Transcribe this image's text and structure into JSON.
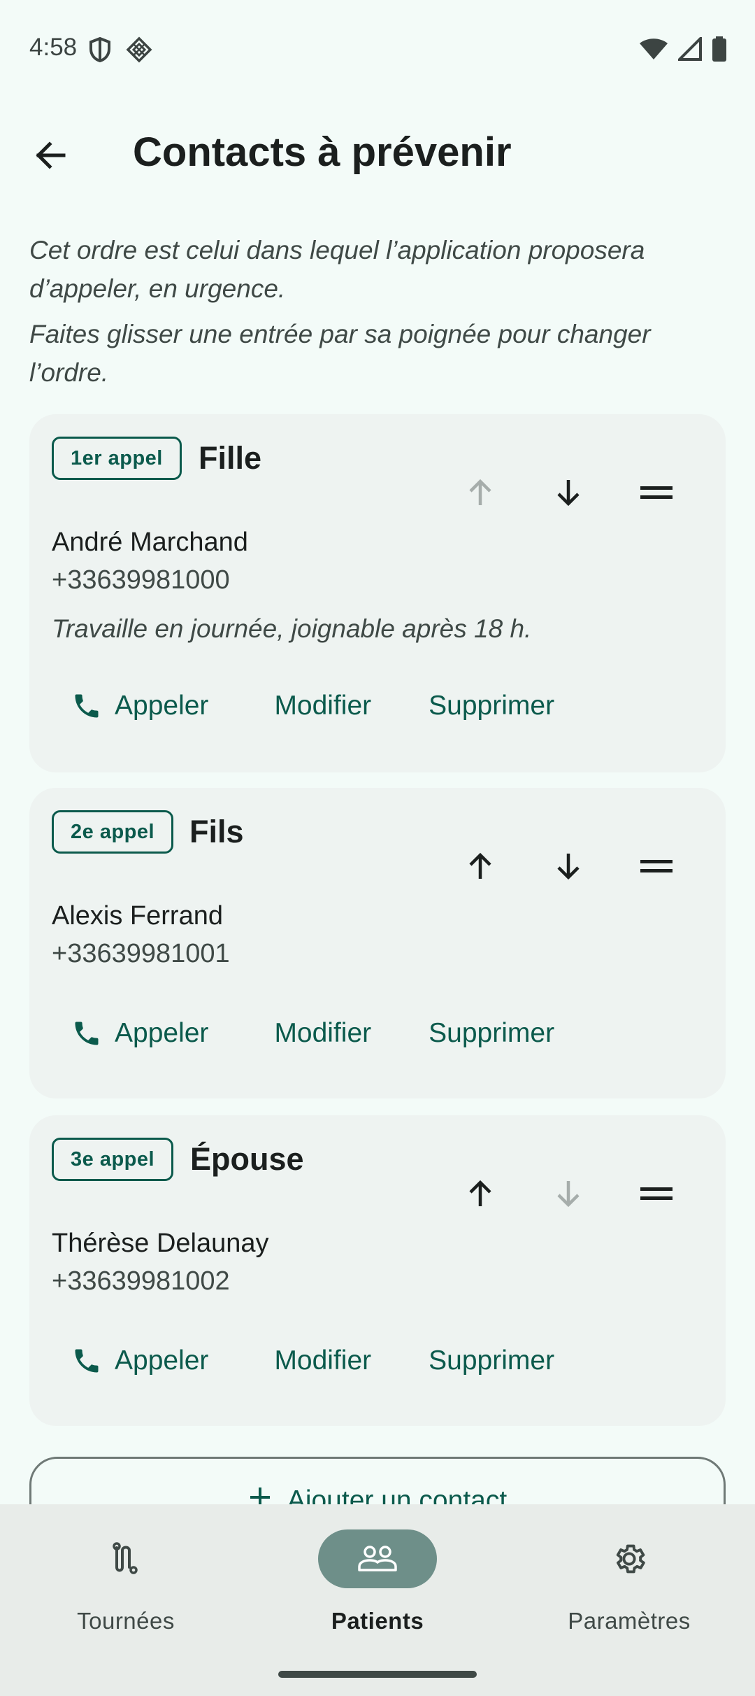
{
  "status_bar": {
    "time": "4:58",
    "left_icons": [
      "shield-icon",
      "diamond-grid-icon"
    ],
    "right_icons": [
      "wifi-icon",
      "signal-icon",
      "battery-icon"
    ]
  },
  "app_bar": {
    "title": "Contacts à prévenir",
    "back_icon": "arrow-back-icon"
  },
  "intro": {
    "line1": "Cet ordre est celui dans lequel l’application proposera d’appeler, en urgence.",
    "line2": "Faites glisser une entrée par sa poignée pour changer l’ordre."
  },
  "contacts": [
    {
      "badge": "1er appel",
      "relation": "Fille",
      "name": "André Marchand",
      "phone": "+33639981000",
      "note": "Travaille en journée, joignable après 18 h.",
      "up_enabled": false,
      "down_enabled": true
    },
    {
      "badge": "2e appel",
      "relation": "Fils",
      "name": "Alexis Ferrand",
      "phone": "+33639981001",
      "note": "",
      "up_enabled": true,
      "down_enabled": true
    },
    {
      "badge": "3e appel",
      "relation": "Épouse",
      "name": "Thérèse Delaunay",
      "phone": "+33639981002",
      "note": "",
      "up_enabled": true,
      "down_enabled": false
    }
  ],
  "actions": {
    "call": "Appeler",
    "modify": "Modifier",
    "delete": "Supprimer"
  },
  "add_contact": {
    "label": "Ajouter un contact"
  },
  "bottom_nav": {
    "items": [
      {
        "label": "Tournées",
        "icon": "route-icon",
        "active": false
      },
      {
        "label": "Patients",
        "icon": "people-icon",
        "active": true
      },
      {
        "label": "Paramètres",
        "icon": "gear-icon",
        "active": false
      }
    ]
  },
  "colors": {
    "background": "#f3fbf8",
    "card": "#eef3f1",
    "accent": "#0b5a4c",
    "nav_active_pill": "#6e8f89",
    "nav_background": "#e8ece9",
    "disabled_icon": "#a6adab"
  }
}
